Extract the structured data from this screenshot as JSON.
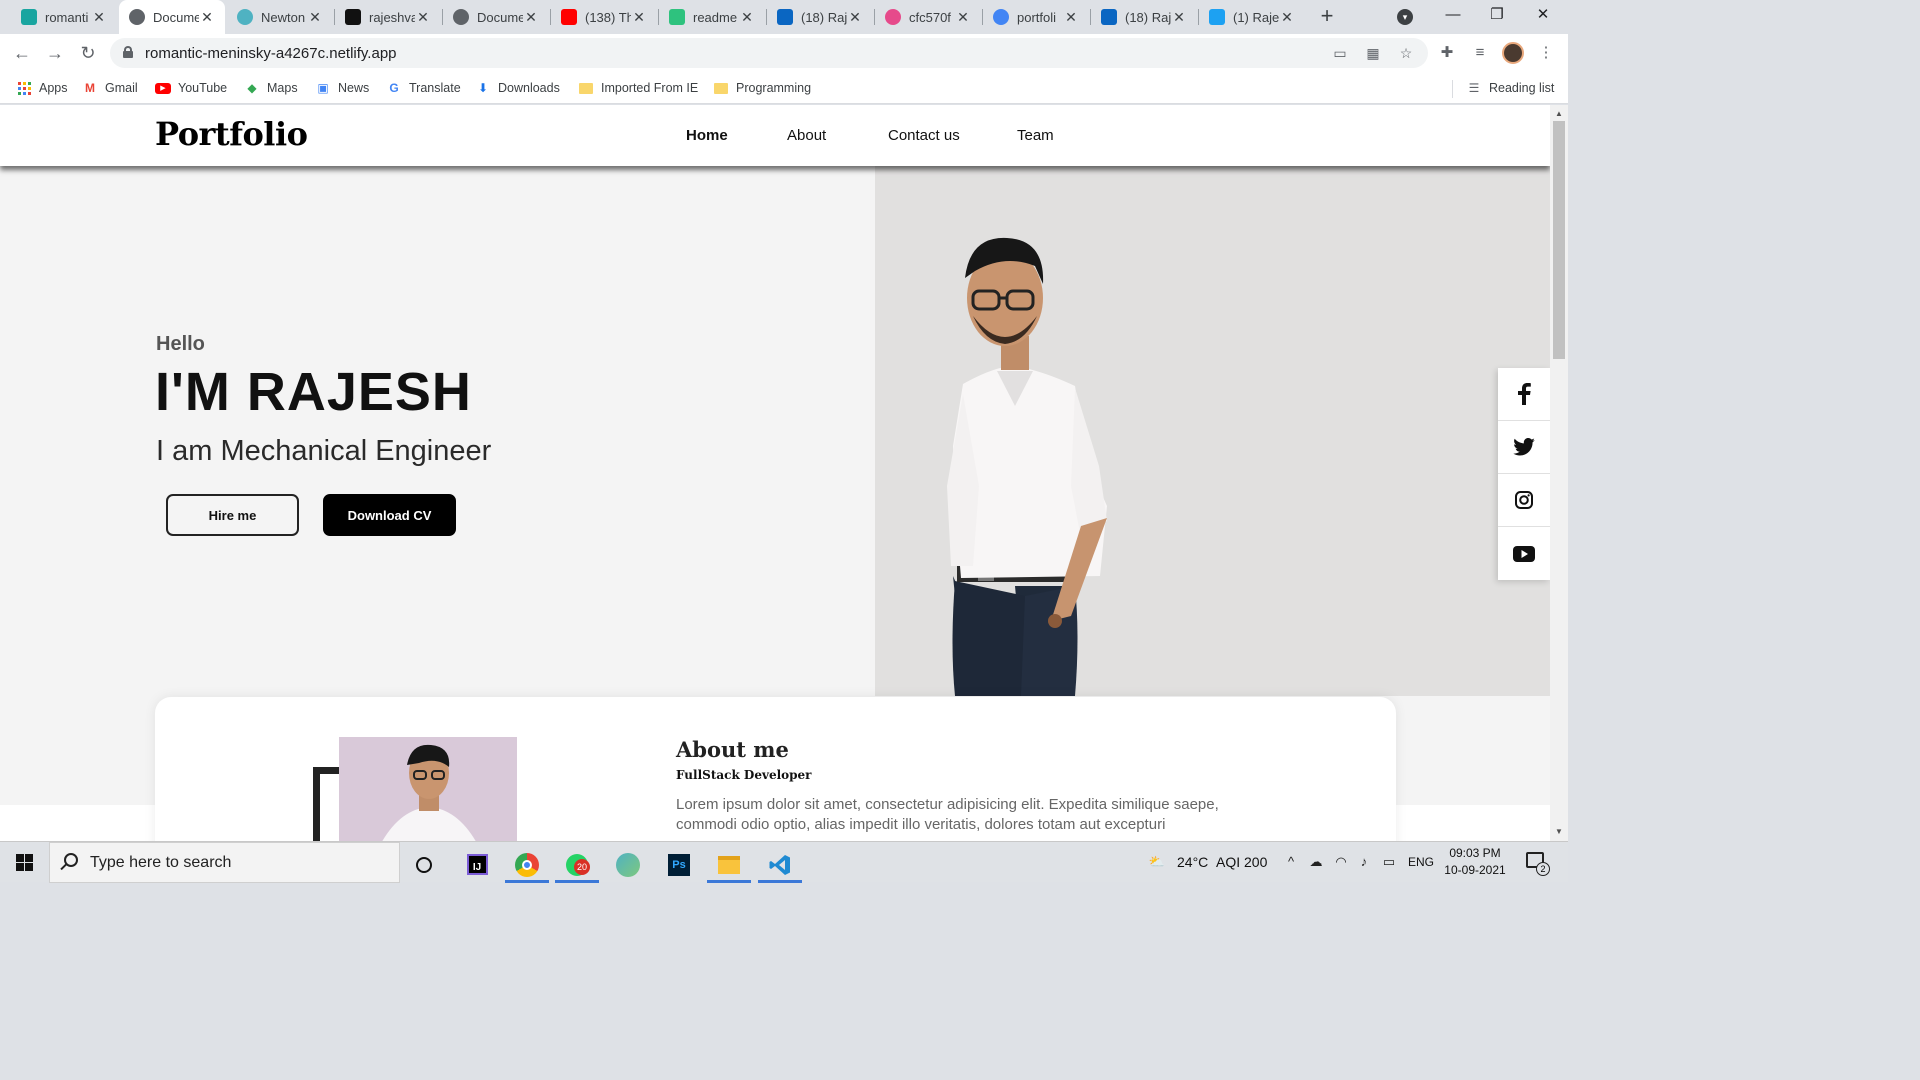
{
  "browser": {
    "tabs": [
      {
        "title": "romanti",
        "icon": "netlify-icon",
        "color": "#19a5a0",
        "active": false
      },
      {
        "title": "Docume",
        "icon": "globe-icon",
        "color": "#5f6368",
        "active": true
      },
      {
        "title": "Newton",
        "icon": "newton-icon",
        "color": "#4fb2c2",
        "active": false
      },
      {
        "title": "rajeshva",
        "icon": "github-icon",
        "color": "#111111",
        "active": false
      },
      {
        "title": "Docume",
        "icon": "globe-icon",
        "color": "#5f6368",
        "active": false
      },
      {
        "title": "(138) Th",
        "icon": "youtube-icon",
        "color": "#ff0000",
        "active": false
      },
      {
        "title": "readme",
        "icon": "readme-icon",
        "color": "#2ec27e",
        "active": false
      },
      {
        "title": "(18) Raj",
        "icon": "linkedin-icon",
        "color": "#0a66c2",
        "active": false
      },
      {
        "title": "cfc570f",
        "icon": "dribbble-icon",
        "color": "#e64a8b",
        "active": false
      },
      {
        "title": "portfoli",
        "icon": "google-icon",
        "color": "#4285f4",
        "active": false
      },
      {
        "title": "(18) Raj",
        "icon": "linkedin-icon",
        "color": "#0a66c2",
        "active": false
      },
      {
        "title": "(1) Raje",
        "icon": "twitter-icon",
        "color": "#1da1f2",
        "active": false
      }
    ],
    "url": "romantic-meninsky-a4267c.netlify.app",
    "bookmarks": [
      {
        "label": "Apps",
        "icon": "apps-grid-icon"
      },
      {
        "label": "Gmail",
        "icon": "gmail-icon"
      },
      {
        "label": "YouTube",
        "icon": "youtube-icon"
      },
      {
        "label": "Maps",
        "icon": "maps-icon"
      },
      {
        "label": "News",
        "icon": "news-icon"
      },
      {
        "label": "Translate",
        "icon": "translate-icon"
      },
      {
        "label": "Downloads",
        "icon": "download-icon"
      },
      {
        "label": "Imported From IE",
        "icon": "folder-icon"
      },
      {
        "label": "Programming",
        "icon": "folder-icon"
      }
    ],
    "reading_list": "Reading list"
  },
  "site": {
    "brand": "Portfolio",
    "nav": [
      "Home",
      "About",
      "Contact us",
      "Team"
    ],
    "hero": {
      "greeting": "Hello",
      "name": "I'M RAJESH",
      "role": "I am Mechanical Engineer",
      "hire_button": "Hire me",
      "download_button": "Download CV"
    },
    "social": [
      "facebook-icon",
      "twitter-icon",
      "instagram-icon",
      "youtube-icon"
    ],
    "about": {
      "title": "About me",
      "subtitle": "FullStack Developer",
      "text": "Lorem ipsum dolor sit amet, consectetur adipisicing elit. Expedita similique saepe, commodi odio optio, alias impedit illo veritatis, dolores totam aut excepturi"
    }
  },
  "taskbar": {
    "search_placeholder": "Type here to search",
    "apps": [
      "cortana-icon",
      "intellij-icon",
      "chrome-icon",
      "whatsapp-icon",
      "newton-icon",
      "photoshop-icon",
      "file-explorer-icon",
      "vscode-icon"
    ],
    "whatsapp_badge": "20",
    "weather": "24°C",
    "aqi": "AQI 200",
    "language": "ENG",
    "time": "09:03 PM",
    "date": "10-09-2021",
    "notifications": "2"
  }
}
